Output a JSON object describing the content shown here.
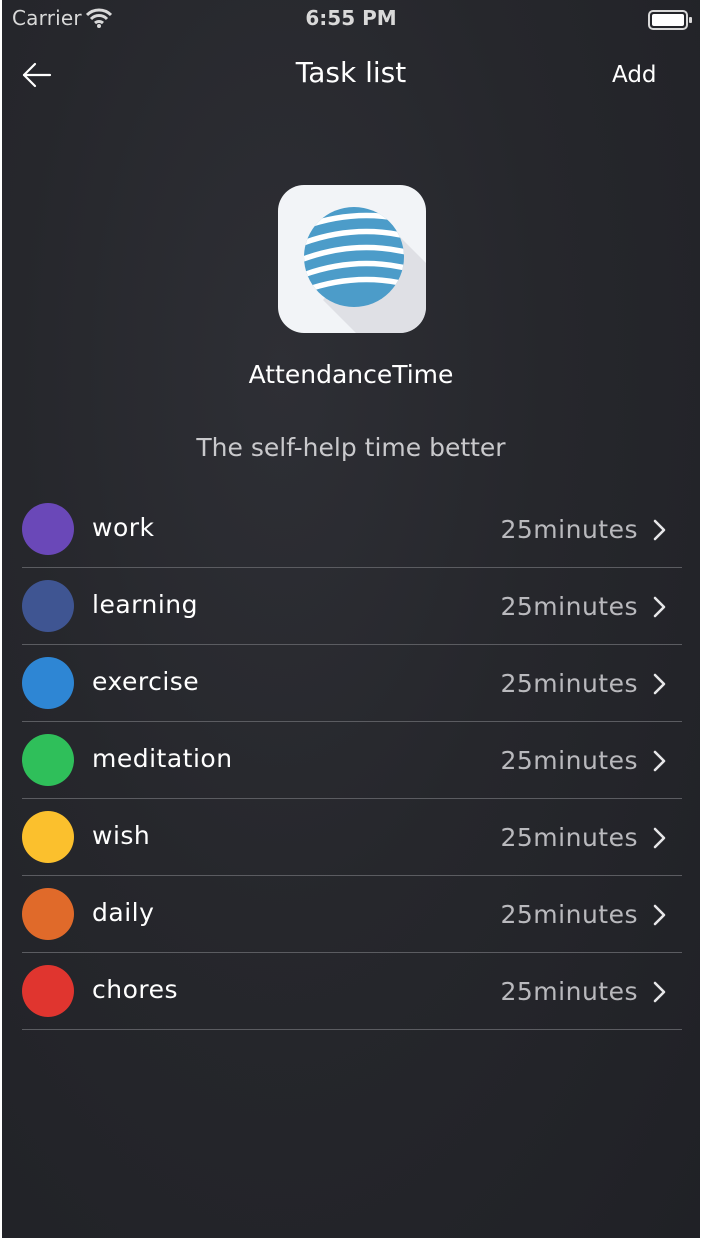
{
  "status_bar": {
    "carrier": "Carrier",
    "time": "6:55 PM",
    "wifi_icon": "wifi-icon",
    "battery_icon": "battery-icon"
  },
  "nav": {
    "back_icon": "back-arrow-icon",
    "title": "Task list",
    "add_label": "Add"
  },
  "app": {
    "icon": "globe-logo-icon",
    "name": "AttendanceTime",
    "tagline": "The self-help time better"
  },
  "tasks": [
    {
      "label": "work",
      "duration": "25minutes",
      "color": "#6a48b8"
    },
    {
      "label": "learning",
      "duration": "25minutes",
      "color": "#3f5592"
    },
    {
      "label": "exercise",
      "duration": "25minutes",
      "color": "#2e86d4"
    },
    {
      "label": "meditation",
      "duration": "25minutes",
      "color": "#2fbf5a"
    },
    {
      "label": "wish",
      "duration": "25minutes",
      "color": "#fbc02d"
    },
    {
      "label": "daily",
      "duration": "25minutes",
      "color": "#e06a2a"
    },
    {
      "label": "chores",
      "duration": "25minutes",
      "color": "#e0352f"
    }
  ],
  "colors": {
    "background": "#26272c",
    "divider": "#5b5c61",
    "text": "#ffffff",
    "secondary_text": "#b9b9bd"
  }
}
